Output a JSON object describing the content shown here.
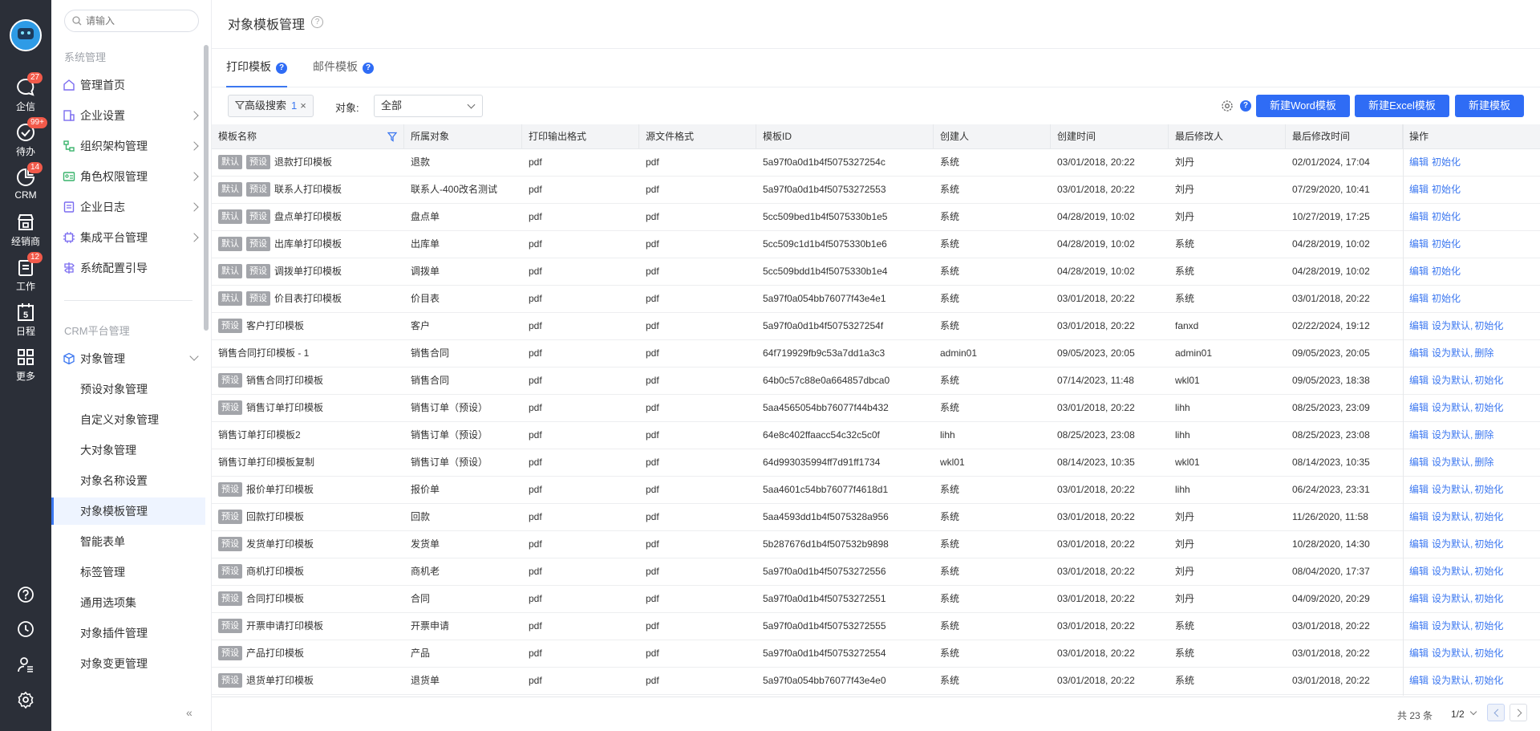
{
  "rail": {
    "items": [
      {
        "label": "企信",
        "icon": "chat-icon",
        "badge": "27"
      },
      {
        "label": "待办",
        "icon": "check-circle-icon",
        "badge": "99+"
      },
      {
        "label": "CRM",
        "icon": "crm-icon",
        "badge": "14"
      },
      {
        "label": "经销商",
        "icon": "store-icon",
        "badge": ""
      },
      {
        "label": "工作",
        "icon": "clipboard-icon",
        "badge": "12"
      },
      {
        "label": "日程",
        "icon": "calendar-icon",
        "badge": "",
        "day": "5"
      },
      {
        "label": "更多",
        "icon": "grid-icon",
        "badge": ""
      }
    ],
    "bottom": [
      "help-icon",
      "clock-icon",
      "user-settings-icon",
      "gear-icon"
    ]
  },
  "sidebar": {
    "search_placeholder": "请输入",
    "group1_title": "系统管理",
    "group1_items": [
      "管理首页",
      "企业设置",
      "组织架构管理",
      "角色权限管理",
      "企业日志",
      "集成平台管理",
      "系统配置引导"
    ],
    "group2_title": "CRM平台管理",
    "object_mgmt": "对象管理",
    "sub_items": [
      "预设对象管理",
      "自定义对象管理",
      "大对象管理",
      "对象名称设置",
      "对象模板管理",
      "智能表单",
      "标签管理",
      "通用选项集",
      "对象插件管理",
      "对象变更管理"
    ],
    "active_sub": "对象模板管理",
    "collapse_icon": "«"
  },
  "header": {
    "title": "对象模板管理",
    "help": "?"
  },
  "tabs": [
    {
      "label": "打印模板",
      "active": true
    },
    {
      "label": "邮件模板",
      "active": false
    }
  ],
  "toolbar": {
    "advanced_search": "高级搜索",
    "filter_count": "1",
    "clear": "×",
    "object_label": "对象:",
    "object_value": "全部",
    "help": "?",
    "btn_word": "新建Word模板",
    "btn_excel": "新建Excel模板",
    "btn_new": "新建模板"
  },
  "table": {
    "columns": [
      "模板名称",
      "所属对象",
      "打印输出格式",
      "源文件格式",
      "模板ID",
      "创建人",
      "创建时间",
      "最后修改人",
      "最后修改时间",
      "操作"
    ],
    "rows": [
      {
        "tags": [
          "默认",
          "预设"
        ],
        "name": "退款打印模板",
        "object": "退款",
        "out": "pdf",
        "src": "pdf",
        "id": "5a97f0a0d1b4f5075327254c",
        "creator": "系统",
        "created": "03/01/2018, 20:22",
        "modifier": "刘丹",
        "modified": "02/01/2024, 17:04",
        "actions": [
          "编辑",
          "初始化"
        ]
      },
      {
        "tags": [
          "默认",
          "预设"
        ],
        "name": "联系人打印模板",
        "object": "联系人-400改名测试",
        "out": "pdf",
        "src": "pdf",
        "id": "5a97f0a0d1b4f50753272553",
        "creator": "系统",
        "created": "03/01/2018, 20:22",
        "modifier": "刘丹",
        "modified": "07/29/2020, 10:41",
        "actions": [
          "编辑",
          "初始化"
        ]
      },
      {
        "tags": [
          "默认",
          "预设"
        ],
        "name": "盘点单打印模板",
        "object": "盘点单",
        "out": "pdf",
        "src": "pdf",
        "id": "5cc509bed1b4f5075330b1e5",
        "creator": "系统",
        "created": "04/28/2019, 10:02",
        "modifier": "刘丹",
        "modified": "10/27/2019, 17:25",
        "actions": [
          "编辑",
          "初始化"
        ]
      },
      {
        "tags": [
          "默认",
          "预设"
        ],
        "name": "出库单打印模板",
        "object": "出库单",
        "out": "pdf",
        "src": "pdf",
        "id": "5cc509c1d1b4f5075330b1e6",
        "creator": "系统",
        "created": "04/28/2019, 10:02",
        "modifier": "系统",
        "modified": "04/28/2019, 10:02",
        "actions": [
          "编辑",
          "初始化"
        ]
      },
      {
        "tags": [
          "默认",
          "预设"
        ],
        "name": "调拨单打印模板",
        "object": "调拨单",
        "out": "pdf",
        "src": "pdf",
        "id": "5cc509bdd1b4f5075330b1e4",
        "creator": "系统",
        "created": "04/28/2019, 10:02",
        "modifier": "系统",
        "modified": "04/28/2019, 10:02",
        "actions": [
          "编辑",
          "初始化"
        ]
      },
      {
        "tags": [
          "默认",
          "预设"
        ],
        "name": "价目表打印模板",
        "object": "价目表",
        "out": "pdf",
        "src": "pdf",
        "id": "5a97f0a054bb76077f43e4e1",
        "creator": "系统",
        "created": "03/01/2018, 20:22",
        "modifier": "系统",
        "modified": "03/01/2018, 20:22",
        "actions": [
          "编辑",
          "初始化"
        ]
      },
      {
        "tags": [
          "预设"
        ],
        "name": "客户打印模板",
        "object": "客户",
        "out": "pdf",
        "src": "pdf",
        "id": "5a97f0a0d1b4f5075327254f",
        "creator": "系统",
        "created": "03/01/2018, 20:22",
        "modifier": "fanxd",
        "modified": "02/22/2024, 19:12",
        "actions": [
          "编辑",
          "设为默认",
          "初始化"
        ]
      },
      {
        "tags": [],
        "name": "销售合同打印模板 - 1",
        "object": "销售合同",
        "out": "pdf",
        "src": "pdf",
        "id": "64f719929fb9c53a7dd1a3c3",
        "creator": "admin01",
        "created": "09/05/2023, 20:05",
        "modifier": "admin01",
        "modified": "09/05/2023, 20:05",
        "actions": [
          "编辑",
          "设为默认",
          "删除"
        ]
      },
      {
        "tags": [
          "预设"
        ],
        "name": "销售合同打印模板",
        "object": "销售合同",
        "out": "pdf",
        "src": "pdf",
        "id": "64b0c57c88e0a664857dbca0",
        "creator": "系统",
        "created": "07/14/2023, 11:48",
        "modifier": "wkl01",
        "modified": "09/05/2023, 18:38",
        "actions": [
          "编辑",
          "设为默认",
          "初始化"
        ]
      },
      {
        "tags": [
          "预设"
        ],
        "name": "销售订单打印模板",
        "object": "销售订单（预设）",
        "out": "pdf",
        "src": "pdf",
        "id": "5aa4565054bb76077f44b432",
        "creator": "系统",
        "created": "03/01/2018, 20:22",
        "modifier": "lihh",
        "modified": "08/25/2023, 23:09",
        "actions": [
          "编辑",
          "设为默认",
          "初始化"
        ]
      },
      {
        "tags": [],
        "name": "销售订单打印模板2",
        "object": "销售订单（预设）",
        "out": "pdf",
        "src": "pdf",
        "id": "64e8c402ffaacc54c32c5c0f",
        "creator": "lihh",
        "created": "08/25/2023, 23:08",
        "modifier": "lihh",
        "modified": "08/25/2023, 23:08",
        "actions": [
          "编辑",
          "设为默认",
          "删除"
        ]
      },
      {
        "tags": [],
        "name": "销售订单打印模板复制",
        "object": "销售订单（预设）",
        "out": "pdf",
        "src": "pdf",
        "id": "64d993035994ff7d91ff1734",
        "creator": "wkl01",
        "created": "08/14/2023, 10:35",
        "modifier": "wkl01",
        "modified": "08/14/2023, 10:35",
        "actions": [
          "编辑",
          "设为默认",
          "删除"
        ]
      },
      {
        "tags": [
          "预设"
        ],
        "name": "报价单打印模板",
        "object": "报价单",
        "out": "pdf",
        "src": "pdf",
        "id": "5aa4601c54bb76077f4618d1",
        "creator": "系统",
        "created": "03/01/2018, 20:22",
        "modifier": "lihh",
        "modified": "06/24/2023, 23:31",
        "actions": [
          "编辑",
          "设为默认",
          "初始化"
        ]
      },
      {
        "tags": [
          "预设"
        ],
        "name": "回款打印模板",
        "object": "回款",
        "out": "pdf",
        "src": "pdf",
        "id": "5aa4593dd1b4f5075328a956",
        "creator": "系统",
        "created": "03/01/2018, 20:22",
        "modifier": "刘丹",
        "modified": "11/26/2020, 11:58",
        "actions": [
          "编辑",
          "设为默认",
          "初始化"
        ]
      },
      {
        "tags": [
          "预设"
        ],
        "name": "发货单打印模板",
        "object": "发货单",
        "out": "pdf",
        "src": "pdf",
        "id": "5b287676d1b4f507532b9898",
        "creator": "系统",
        "created": "03/01/2018, 20:22",
        "modifier": "刘丹",
        "modified": "10/28/2020, 14:30",
        "actions": [
          "编辑",
          "设为默认",
          "初始化"
        ]
      },
      {
        "tags": [
          "预设"
        ],
        "name": "商机打印模板",
        "object": "商机老",
        "out": "pdf",
        "src": "pdf",
        "id": "5a97f0a0d1b4f50753272556",
        "creator": "系统",
        "created": "03/01/2018, 20:22",
        "modifier": "刘丹",
        "modified": "08/04/2020, 17:37",
        "actions": [
          "编辑",
          "设为默认",
          "初始化"
        ]
      },
      {
        "tags": [
          "预设"
        ],
        "name": "合同打印模板",
        "object": "合同",
        "out": "pdf",
        "src": "pdf",
        "id": "5a97f0a0d1b4f50753272551",
        "creator": "系统",
        "created": "03/01/2018, 20:22",
        "modifier": "刘丹",
        "modified": "04/09/2020, 20:29",
        "actions": [
          "编辑",
          "设为默认",
          "初始化"
        ]
      },
      {
        "tags": [
          "预设"
        ],
        "name": "开票申请打印模板",
        "object": "开票申请",
        "out": "pdf",
        "src": "pdf",
        "id": "5a97f0a0d1b4f50753272555",
        "creator": "系统",
        "created": "03/01/2018, 20:22",
        "modifier": "系统",
        "modified": "03/01/2018, 20:22",
        "actions": [
          "编辑",
          "设为默认",
          "初始化"
        ]
      },
      {
        "tags": [
          "预设"
        ],
        "name": "产品打印模板",
        "object": "产品",
        "out": "pdf",
        "src": "pdf",
        "id": "5a97f0a0d1b4f50753272554",
        "creator": "系统",
        "created": "03/01/2018, 20:22",
        "modifier": "系统",
        "modified": "03/01/2018, 20:22",
        "actions": [
          "编辑",
          "设为默认",
          "初始化"
        ]
      },
      {
        "tags": [
          "预设"
        ],
        "name": "退货单打印模板",
        "object": "退货单",
        "out": "pdf",
        "src": "pdf",
        "id": "5a97f0a054bb76077f43e4e0",
        "creator": "系统",
        "created": "03/01/2018, 20:22",
        "modifier": "系统",
        "modified": "03/01/2018, 20:22",
        "actions": [
          "编辑",
          "设为默认",
          "初始化"
        ]
      }
    ]
  },
  "pagination": {
    "total": "共 23 条",
    "pages": "1/2"
  },
  "colors": {
    "accent": "#2f6cf5",
    "rail_bg": "#2b2f38",
    "badge": "#f25a4a",
    "tag_bg": "#a3a5aa"
  }
}
